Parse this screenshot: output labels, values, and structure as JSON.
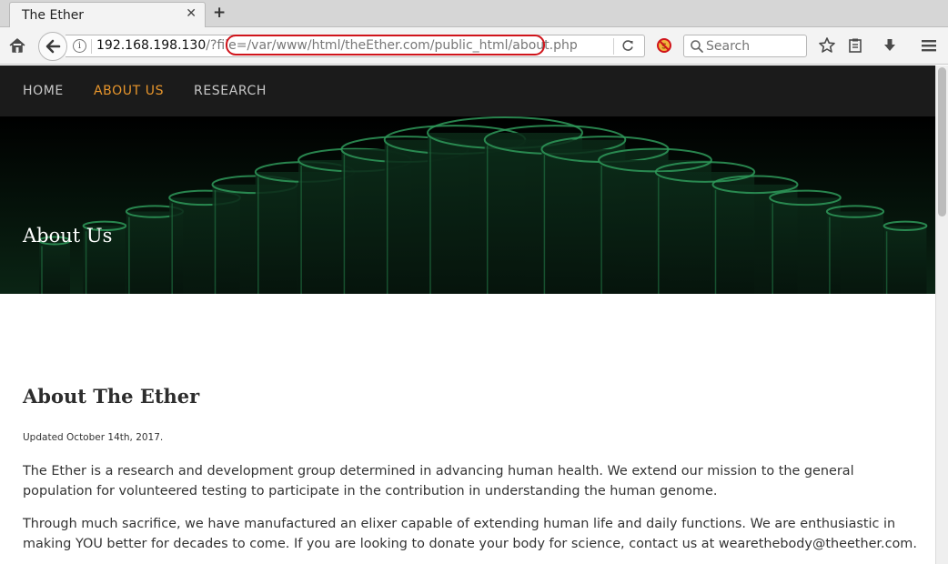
{
  "browser": {
    "tab_title": "The Ether",
    "tab_close": "✕",
    "new_tab": "+",
    "url_host": "192.168.198.130",
    "url_query": "/?file",
    "url_path": "=/var/www/html/theEther.com/public_html/about.php",
    "search_placeholder": "Search"
  },
  "site": {
    "nav": [
      {
        "label": "HOME"
      },
      {
        "label": "ABOUT US"
      },
      {
        "label": "RESEARCH"
      }
    ],
    "active_nav": "ABOUT US",
    "accent_color": "#e8962c"
  },
  "hero": {
    "title": "About Us"
  },
  "main": {
    "heading": "About The Ether",
    "updated": "Updated October 14th, 2017.",
    "paragraphs": [
      "The Ether is a research and development group determined in advancing human health. We extend our mission to the general population for volunteered testing to participate in the contribution in understanding the human genome.",
      "Through much sacrifice, we have manufactured an elixer capable of extending human life and daily functions. We are enthusiastic in making YOU better for decades to come. If you are looking to donate your body for science, contact us at wearethebody@theether.com."
    ]
  },
  "icons": {
    "home": "home-icon",
    "back": "back-arrow-icon",
    "info": "info-icon",
    "reload": "reload-icon",
    "noscript": "noscript-icon",
    "search": "search-icon",
    "bookmark": "star-icon",
    "reading_list": "clipboard-icon",
    "download": "download-icon",
    "menu": "hamburger-menu-icon"
  }
}
